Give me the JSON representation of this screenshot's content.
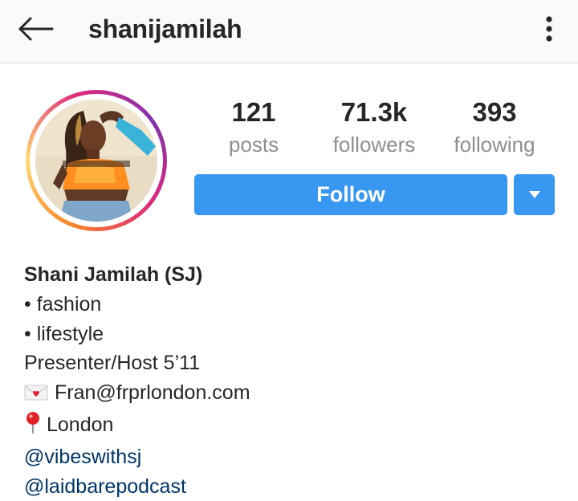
{
  "header": {
    "username": "shanijamilah",
    "back_icon": "arrow-left-icon",
    "more_icon": "more-vertical-icon"
  },
  "profile": {
    "avatar_icon": "profile-photo",
    "stats": [
      {
        "value": "121",
        "label": "posts"
      },
      {
        "value": "71.3k",
        "label": "followers"
      },
      {
        "value": "393",
        "label": "following"
      }
    ],
    "follow_label": "Follow",
    "dropdown_icon": "caret-down-icon"
  },
  "bio": {
    "name": "Shani Jamilah (SJ)",
    "line1": "• fashion",
    "line2": "• lifestyle",
    "line3": "Presenter/Host 5’11",
    "email": "Fran@frprlondon.com",
    "email_icon": "love-letter-icon",
    "location": "London",
    "location_icon": "round-pushpin-icon",
    "link1": "@vibeswithsj",
    "link2": "@laidbarepodcast"
  },
  "colors": {
    "accent": "#3897f0",
    "link": "#003569",
    "muted": "#8e8e8e",
    "text": "#262626"
  }
}
